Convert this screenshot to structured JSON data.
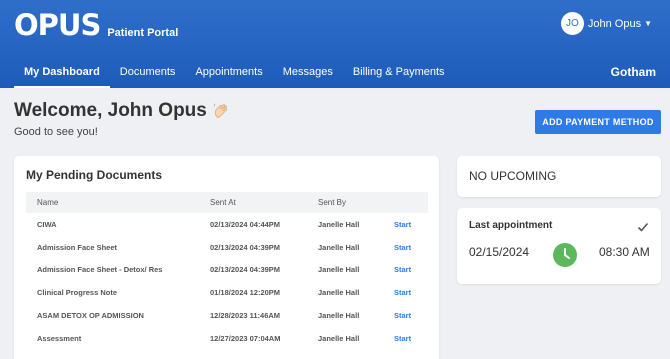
{
  "brand": {
    "logo_text": "OPUS",
    "portal_label": "Patient Portal"
  },
  "user": {
    "initials": "JO",
    "name": "John Opus"
  },
  "nav": {
    "items": [
      {
        "label": "My Dashboard",
        "active": true
      },
      {
        "label": "Documents"
      },
      {
        "label": "Appointments"
      },
      {
        "label": "Messages"
      },
      {
        "label": "Billing & Payments"
      }
    ],
    "organization": "Gotham"
  },
  "welcome": {
    "title": "Welcome, John Opus",
    "subtitle": "Good to see you!"
  },
  "add_payment_label": "ADD PAYMENT METHOD",
  "pending_documents": {
    "title": "My Pending Documents",
    "columns": [
      "Name",
      "Sent At",
      "Sent By",
      ""
    ],
    "rows": [
      {
        "name": "CIWA",
        "sent_at": "02/13/2024 04:44PM",
        "sent_by": "Janelle Hall",
        "action": "Start"
      },
      {
        "name": "Admission Face Sheet",
        "sent_at": "02/13/2024 04:39PM",
        "sent_by": "Janelle Hall",
        "action": "Start"
      },
      {
        "name": "Admission Face Sheet - Detox/ Res",
        "sent_at": "02/13/2024 04:39PM",
        "sent_by": "Janelle Hall",
        "action": "Start"
      },
      {
        "name": "Clinical Progress Note",
        "sent_at": "01/18/2024 12:20PM",
        "sent_by": "Janelle Hall",
        "action": "Start"
      },
      {
        "name": "ASAM DETOX OP ADMISSION",
        "sent_at": "12/28/2023 11:46AM",
        "sent_by": "Janelle Hall",
        "action": "Start"
      },
      {
        "name": "Assessment",
        "sent_at": "12/27/2023 07:04AM",
        "sent_by": "Janelle Hall",
        "action": "Start"
      }
    ]
  },
  "upcoming": {
    "text": "NO UPCOMING"
  },
  "last_appointment": {
    "title": "Last appointment",
    "date": "02/15/2024",
    "time": "08:30 AM"
  },
  "colors": {
    "header": "#2f6fca",
    "accent": "#2f7ae5",
    "clock": "#5cb85c"
  },
  "icons": {
    "wave": "waving-hand-icon",
    "user_menu": "caret-down-icon",
    "check": "check-icon",
    "clock": "clock-icon"
  }
}
